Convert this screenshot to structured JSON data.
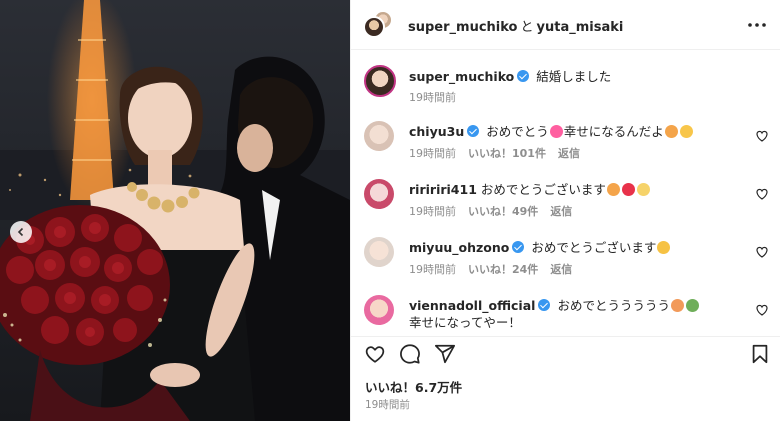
{
  "post": {
    "header": {
      "user1": "super_muchiko",
      "joiner": "と",
      "user2": "yuta_misaki"
    },
    "caption": {
      "username": "super_muchiko",
      "text": "結婚しました",
      "time": "19時間前"
    },
    "comments": [
      {
        "username": "chiyu3u",
        "verified": true,
        "text_before": "おめでとう",
        "text_after": "幸せになるんだよ",
        "time": "19時間前",
        "likes": "いいね！101件",
        "reply": "返信"
      },
      {
        "username": "riririri411",
        "verified": false,
        "text_before": "おめでとうございます",
        "text_after": "",
        "time": "19時間前",
        "likes": "いいね！49件",
        "reply": "返信"
      },
      {
        "username": "miyuu_ohzono",
        "verified": true,
        "text_before": "おめでとうございます",
        "text_after": "",
        "time": "19時間前",
        "likes": "いいね！24件",
        "reply": "返信"
      },
      {
        "username": "viennadoll_official",
        "verified": true,
        "text_before": "おめでとううううう",
        "text_line2": "幸せになってやー！"
      }
    ],
    "likes_total": "いいね！6.7万件",
    "posted": "19時間前"
  },
  "icons": {
    "header_more": "more-dots-icon",
    "like": "heart-icon",
    "comment": "comment-bubble-icon",
    "share": "paper-plane-icon",
    "save": "bookmark-icon",
    "carousel_prev": "chevron-left-icon",
    "verified": "verified-badge-icon"
  },
  "colors": {
    "verified": "#3897f0",
    "muted": "#8e8e8e",
    "text": "#262626"
  }
}
